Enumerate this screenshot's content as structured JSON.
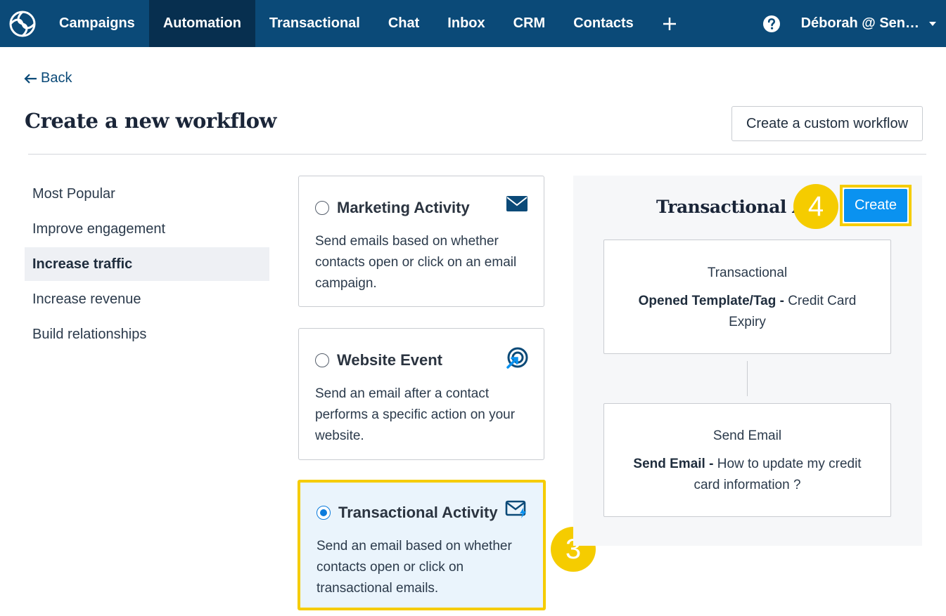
{
  "nav": {
    "items": [
      {
        "label": "Campaigns",
        "active": false
      },
      {
        "label": "Automation",
        "active": true
      },
      {
        "label": "Transactional",
        "active": false
      },
      {
        "label": "Chat",
        "active": false
      },
      {
        "label": "Inbox",
        "active": false
      },
      {
        "label": "CRM",
        "active": false
      },
      {
        "label": "Contacts",
        "active": false
      }
    ],
    "user_label": "Déborah @ Sen…",
    "colors": {
      "bar": "#0b4a78",
      "active": "#072f4f"
    }
  },
  "back_label": "Back",
  "page_title": "Create a new workflow",
  "custom_workflow_label": "Create a custom workflow",
  "categories": [
    {
      "label": "Most Popular",
      "active": false
    },
    {
      "label": "Improve engagement",
      "active": false
    },
    {
      "label": "Increase traffic",
      "active": true
    },
    {
      "label": "Increase revenue",
      "active": false
    },
    {
      "label": "Build relationships",
      "active": false
    }
  ],
  "cards": [
    {
      "title": "Marketing Activity",
      "desc": "Send emails based on whether contacts open or click on an email campaign.",
      "icon": "envelope-icon",
      "selected": false
    },
    {
      "title": "Website Event",
      "desc": "Send an email after a contact performs a specific action on your website.",
      "icon": "target-cursor-icon",
      "selected": false
    },
    {
      "title": "Transactional Activity",
      "desc": "Send an email based on whether contacts open or click on transactional emails.",
      "icon": "envelope-bolt-icon",
      "selected": true
    }
  ],
  "preview": {
    "title": "Transactional Activity",
    "create_label": "Create",
    "steps": [
      {
        "label": "Transactional",
        "detail_bold": "Opened Template/Tag -",
        "detail_text": " Credit Card Expiry"
      },
      {
        "label": "Send Email",
        "detail_bold": "Send Email -",
        "detail_text": " How to update my credit card information ?"
      }
    ]
  },
  "badges": {
    "step3": "3",
    "step4": "4"
  },
  "colors": {
    "accent": "#0a92f0",
    "highlight": "#f5cc00",
    "selected_card_bg": "#eaf4fc"
  }
}
